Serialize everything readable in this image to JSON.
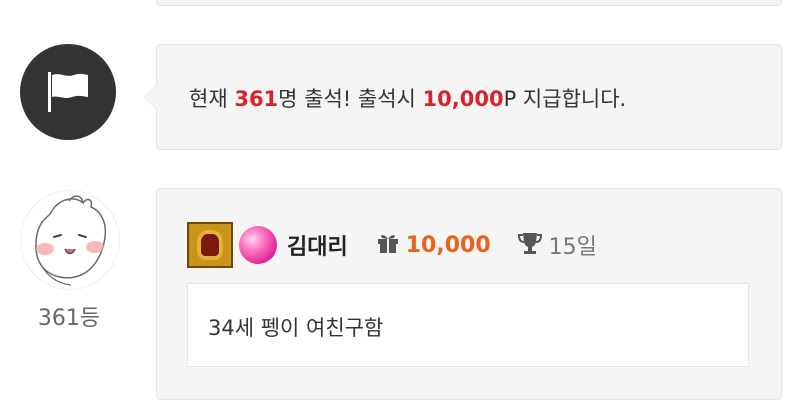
{
  "notice": {
    "prefix": "현재 ",
    "count": "361",
    "middle": "명 출석! 출석시 ",
    "reward": "10,000",
    "suffix": "P 지급합니다."
  },
  "entry": {
    "rank_label": "361등",
    "username": "김대리",
    "points": "10,000",
    "days": "15일",
    "comment": "34세 펭이 여친구함"
  },
  "colors": {
    "accent_red": "#d8232a",
    "points_orange": "#e8621a",
    "flag_circle": "#333333"
  },
  "icons": {
    "flag": "flag-icon",
    "gift": "gift-icon",
    "trophy": "trophy-icon",
    "gem": "gem-icon",
    "badge": "badge-icon"
  }
}
